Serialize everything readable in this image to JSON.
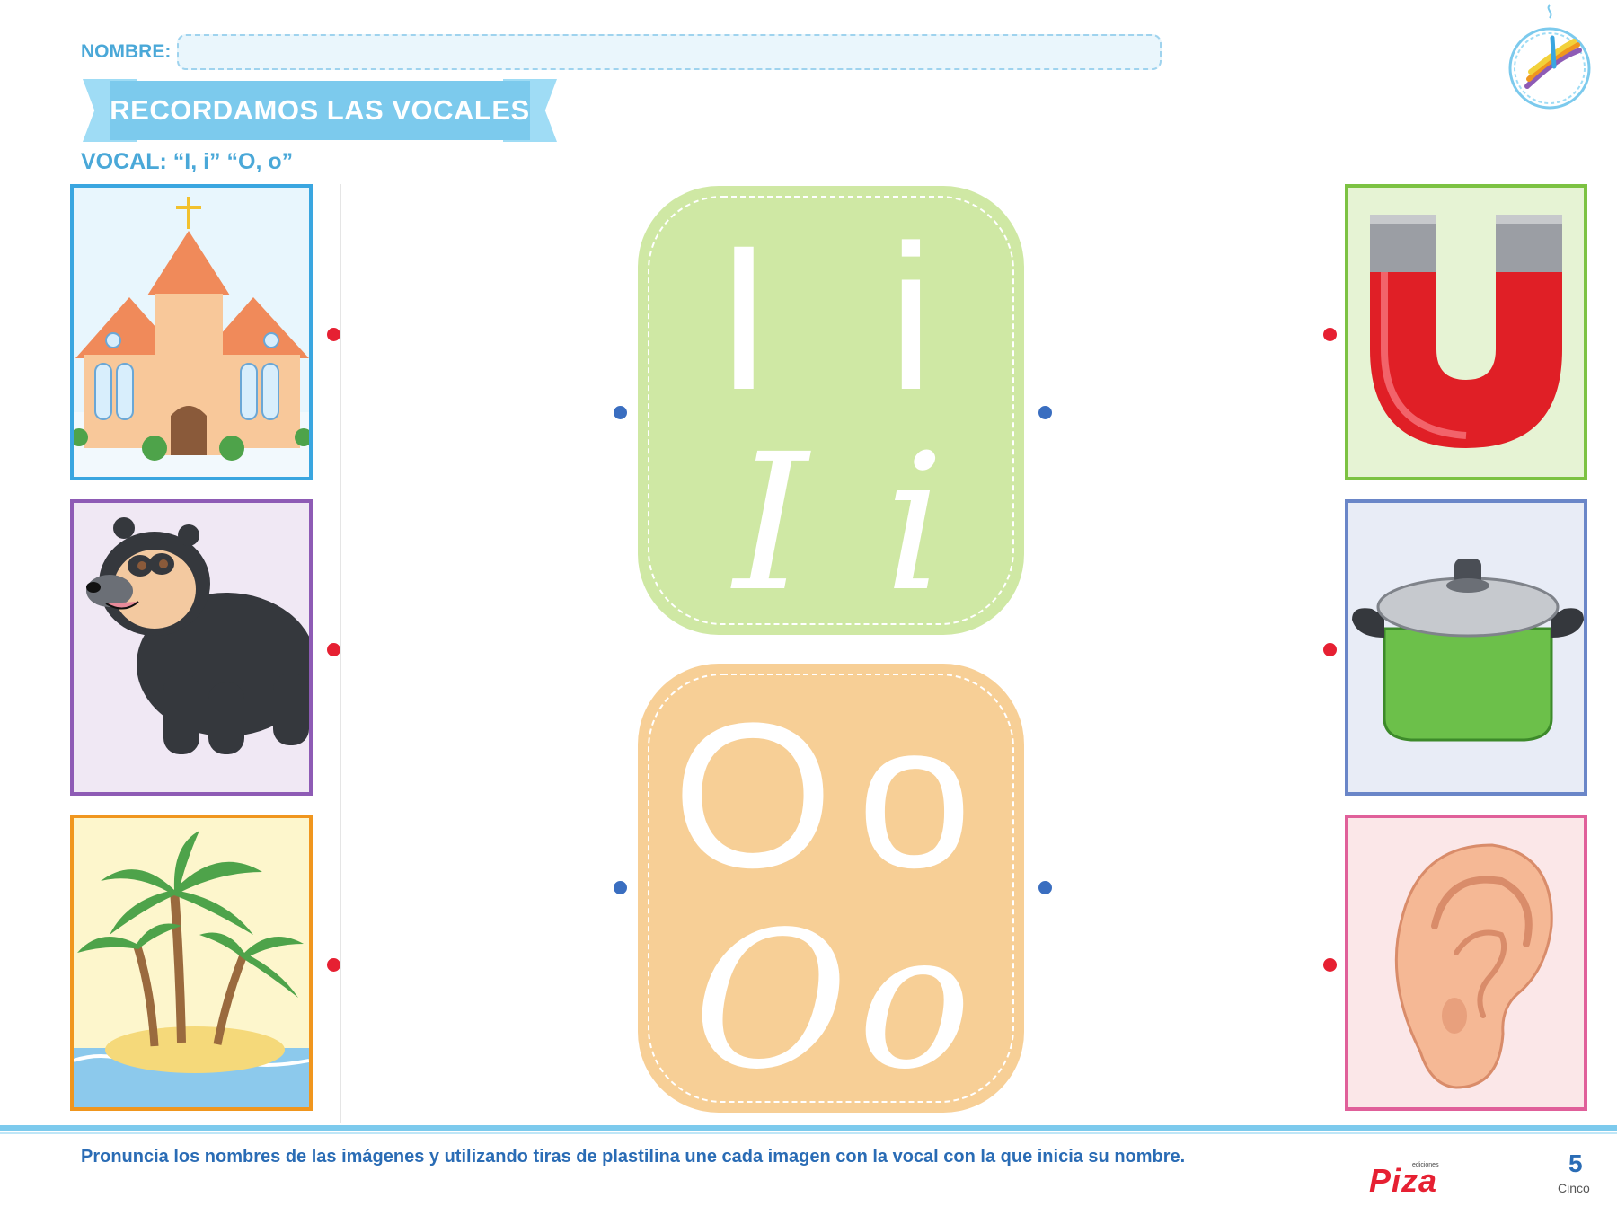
{
  "header": {
    "name_label": "NOMBRE:",
    "title": "RECORDAMOS LAS VOCALES",
    "subtitle": "VOCAL: “I, i” “O, o”",
    "logo_icon": "rainbow-hand-badge-icon"
  },
  "left_pictures": [
    {
      "name": "iglesia",
      "icon": "church-icon",
      "border": "#3aa6e0"
    },
    {
      "name": "oso",
      "icon": "spectacled-bear-icon",
      "border": "#8e5bb5"
    },
    {
      "name": "isla",
      "icon": "palm-island-icon",
      "border": "#f0961e"
    }
  ],
  "right_pictures": [
    {
      "name": "imán",
      "icon": "magnet-icon",
      "border": "#7cc242"
    },
    {
      "name": "olla",
      "icon": "cooking-pot-icon",
      "border": "#6a86c8"
    },
    {
      "name": "oreja",
      "icon": "ear-icon",
      "border": "#e0609a"
    }
  ],
  "vowel_cards": [
    {
      "print": "I i",
      "cursive": "I i",
      "color": "#cfe8a4"
    },
    {
      "print": "O o",
      "cursive": "O o",
      "color": "#f7cf96"
    }
  ],
  "footer": {
    "instruction": "Pronuncia los nombres de las imágenes y utilizando tiras de plastilina une cada imagen con la vocal con la que inicia su nombre.",
    "brand": "Piza",
    "brand_prefix": "ediciones",
    "page_number": "5",
    "page_word": "Cinco"
  }
}
